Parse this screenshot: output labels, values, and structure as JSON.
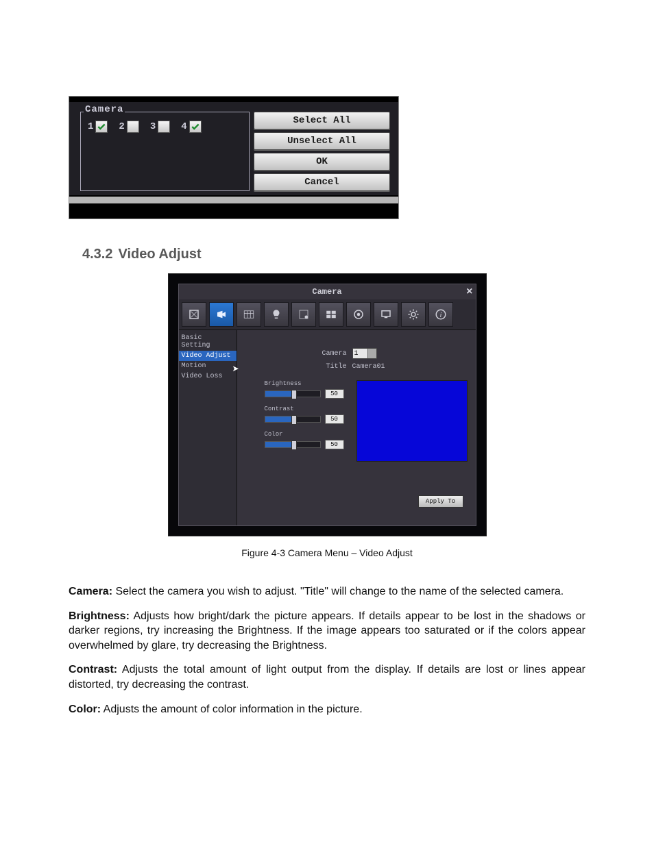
{
  "camsel": {
    "legend": "Camera",
    "items": [
      {
        "label": "1",
        "checked": true
      },
      {
        "label": "2",
        "checked": false
      },
      {
        "label": "3",
        "checked": false
      },
      {
        "label": "4",
        "checked": true
      }
    ],
    "buttons": {
      "select_all": "Select All",
      "unselect_all": "Unselect All",
      "ok": "OK",
      "cancel": "Cancel"
    }
  },
  "section": {
    "number": "4.3.2",
    "title": "Video Adjust"
  },
  "vawin": {
    "title": "Camera",
    "sidebar": [
      "Basic Setting",
      "Video Adjust",
      "Motion",
      "Video Loss"
    ],
    "camera_label": "Camera",
    "camera_value": "1",
    "title_label": "Title",
    "title_value": "Camera01",
    "sliders": {
      "brightness": {
        "label": "Brightness",
        "value": "50"
      },
      "contrast": {
        "label": "Contrast",
        "value": "50"
      },
      "color": {
        "label": "Color",
        "value": "50"
      }
    },
    "apply": "Apply To"
  },
  "figcaption": "Figure 4-3  Camera Menu – Video Adjust",
  "body": {
    "camera_head": "Camera:",
    "camera_text": " Select the camera you wish to adjust. \"Title\" will change to the name of the selected camera.",
    "brightness_head": "Brightness:",
    "brightness_text": " Adjusts how bright/dark the picture appears.  If details appear to be lost in the shadows or darker regions, try increasing the Brightness.  If the image appears too saturated or if the colors appear overwhelmed by glare, try decreasing the Brightness.",
    "contrast_head": "Contrast:",
    "contrast_text": " Adjusts the total amount of light output from the display. If details are lost or lines appear distorted, try decreasing the contrast.",
    "color_head": "Color:",
    "color_text": " Adjusts the amount of color information in the picture."
  }
}
